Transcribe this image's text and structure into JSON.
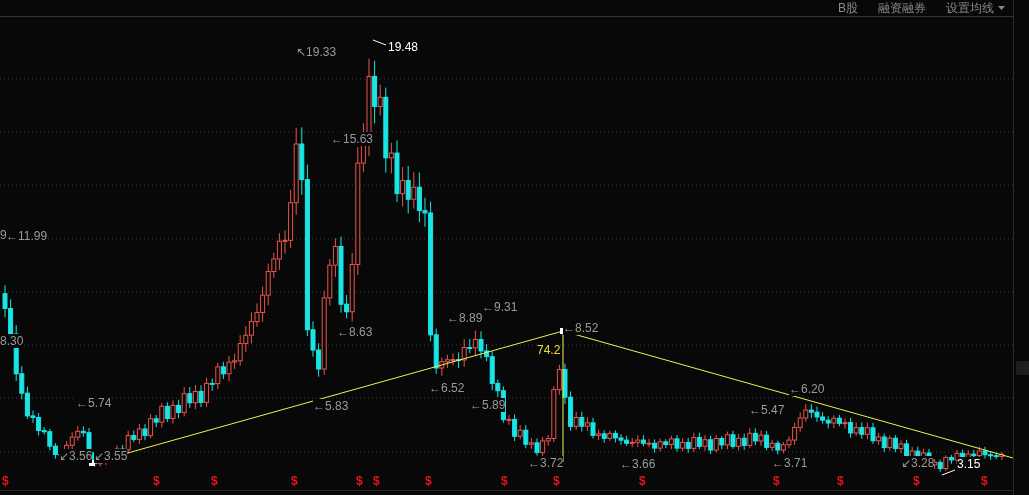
{
  "toolbar": {
    "items": [
      {
        "label": "B股",
        "kind": "plain"
      },
      {
        "label": "融资融券",
        "kind": "plain"
      },
      {
        "label": "设置均线",
        "kind": "dropdown"
      }
    ]
  },
  "chart": {
    "price_labels": [
      {
        "text": "9",
        "kind": "plain"
      },
      {
        "text": "←11.99",
        "kind": "plain"
      },
      {
        "text": "8.30",
        "kind": "plain"
      },
      {
        "text": "←5.74",
        "kind": "plain"
      },
      {
        "text": "↙3.56",
        "kind": "plain"
      },
      {
        "text": "↙3.55",
        "kind": "plain"
      },
      {
        "text": "↖19.33",
        "kind": "plain"
      },
      {
        "text": "19.48",
        "kind": "extreme"
      },
      {
        "text": "←15.63",
        "kind": "plain"
      },
      {
        "text": "←8.63",
        "kind": "plain"
      },
      {
        "text": "←5.83",
        "kind": "plain"
      },
      {
        "text": "←6.52",
        "kind": "plain"
      },
      {
        "text": "←8.89",
        "kind": "plain"
      },
      {
        "text": "←9.31",
        "kind": "plain"
      },
      {
        "text": "←5.89",
        "kind": "plain"
      },
      {
        "text": "←3.72",
        "kind": "plain"
      },
      {
        "text": "74.2",
        "kind": "ratio"
      },
      {
        "text": "←8.52",
        "kind": "plain"
      },
      {
        "text": "←3.66",
        "kind": "plain"
      },
      {
        "text": "←5.47",
        "kind": "plain"
      },
      {
        "text": "←6.20",
        "kind": "plain"
      },
      {
        "text": "←3.71",
        "kind": "plain"
      },
      {
        "text": "↙3.28",
        "kind": "plain"
      },
      {
        "text": "3.15",
        "kind": "extreme"
      }
    ],
    "markers": [
      "$",
      "$",
      "$",
      "$",
      "$",
      "$",
      "$",
      "$",
      "$",
      "$",
      "$",
      "$",
      "$",
      "$"
    ]
  }
}
